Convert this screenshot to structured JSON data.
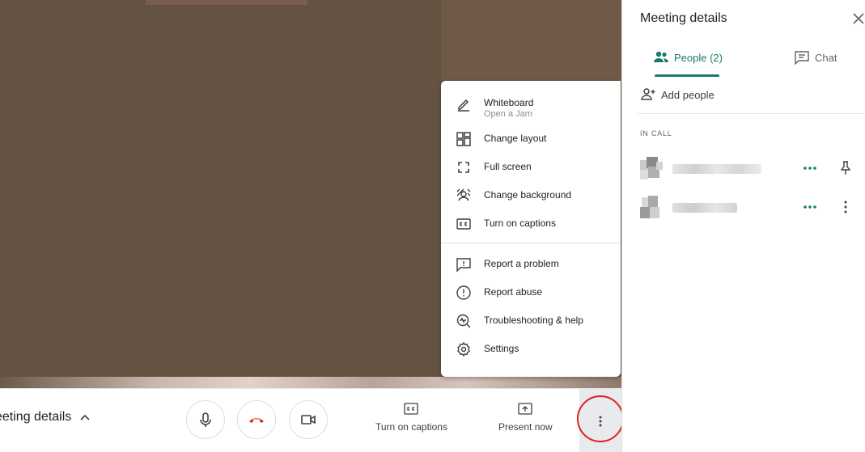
{
  "menu": {
    "items": [
      {
        "label": "Whiteboard",
        "sublabel": "Open a Jam",
        "icon": "pencil-icon"
      },
      {
        "label": "Change layout",
        "icon": "layout-icon"
      },
      {
        "label": "Full screen",
        "icon": "fullscreen-icon"
      },
      {
        "label": "Change background",
        "icon": "background-icon"
      },
      {
        "label": "Turn on captions",
        "icon": "captions-icon"
      },
      {
        "label": "Report a problem",
        "icon": "report-problem-icon"
      },
      {
        "label": "Report abuse",
        "icon": "report-abuse-icon"
      },
      {
        "label": "Troubleshooting & help",
        "icon": "troubleshooting-icon"
      },
      {
        "label": "Settings",
        "icon": "gear-icon"
      }
    ]
  },
  "bottom_bar": {
    "meeting_details_label": "eeting details",
    "captions_label": "Turn on captions",
    "present_label": "Present now"
  },
  "panel": {
    "title": "Meeting details",
    "tabs": [
      {
        "label": "People (2)",
        "icon": "people-icon",
        "active": true
      },
      {
        "label": "Chat",
        "icon": "chat-icon",
        "active": false
      }
    ],
    "add_people_label": "Add people",
    "section_label": "IN CALL"
  },
  "colors": {
    "accent": "#1a7a6c",
    "hangup": "#d93025",
    "annotation": "#e02020",
    "video_bg": "#645342"
  }
}
